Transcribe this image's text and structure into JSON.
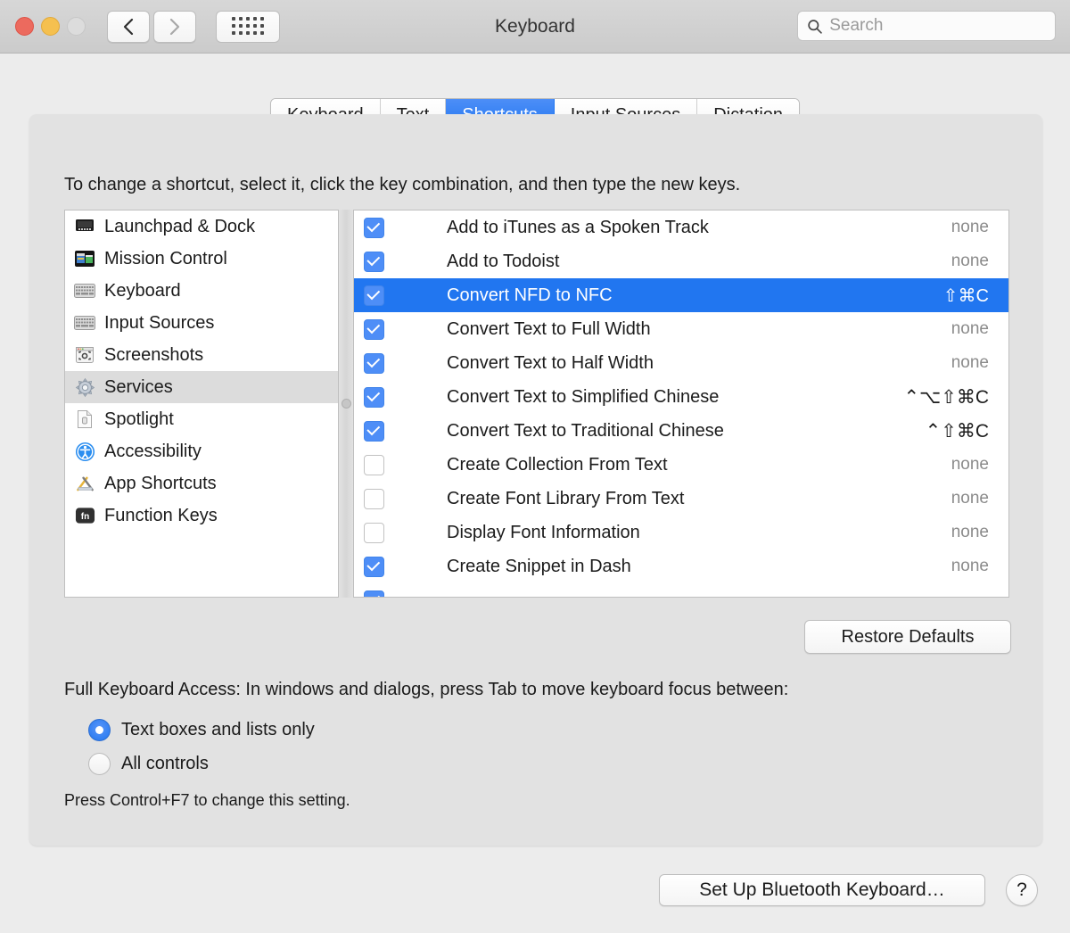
{
  "window": {
    "title": "Keyboard",
    "traffic_lights": [
      "close",
      "minimize",
      "zoom"
    ],
    "back_label": "Back",
    "forward_label": "Forward",
    "grid_label": "Show All"
  },
  "search": {
    "placeholder": "Search",
    "value": ""
  },
  "tabs": [
    {
      "label": "Keyboard",
      "active": false
    },
    {
      "label": "Text",
      "active": false
    },
    {
      "label": "Shortcuts",
      "active": true
    },
    {
      "label": "Input Sources",
      "active": false
    },
    {
      "label": "Dictation",
      "active": false
    }
  ],
  "hint": "To change a shortcut, select it, click the key combination, and then type the new keys.",
  "sidebar": {
    "items": [
      {
        "label": "Launchpad & Dock",
        "icon": "launchpad-dock-icon",
        "selected": false
      },
      {
        "label": "Mission Control",
        "icon": "mission-control-icon",
        "selected": false
      },
      {
        "label": "Keyboard",
        "icon": "keyboard-icon",
        "selected": false
      },
      {
        "label": "Input Sources",
        "icon": "input-sources-icon",
        "selected": false
      },
      {
        "label": "Screenshots",
        "icon": "screenshots-icon",
        "selected": false
      },
      {
        "label": "Services",
        "icon": "services-gear-icon",
        "selected": true
      },
      {
        "label": "Spotlight",
        "icon": "spotlight-icon",
        "selected": false
      },
      {
        "label": "Accessibility",
        "icon": "accessibility-icon",
        "selected": false
      },
      {
        "label": "App Shortcuts",
        "icon": "app-shortcuts-icon",
        "selected": false
      },
      {
        "label": "Function Keys",
        "icon": "function-keys-fn-icon",
        "selected": false
      }
    ]
  },
  "shortcuts": {
    "none_label": "none",
    "rows": [
      {
        "name": "Add to iTunes as a Spoken Track",
        "key": "none",
        "checked": true,
        "selected": false,
        "has_key": false
      },
      {
        "name": "Add to Todoist",
        "key": "none",
        "checked": true,
        "selected": false,
        "has_key": false
      },
      {
        "name": "Convert NFD to NFC",
        "key": "⇧⌘C",
        "checked": true,
        "selected": true,
        "has_key": true
      },
      {
        "name": "Convert Text to Full Width",
        "key": "none",
        "checked": true,
        "selected": false,
        "has_key": false
      },
      {
        "name": "Convert Text to Half Width",
        "key": "none",
        "checked": true,
        "selected": false,
        "has_key": false
      },
      {
        "name": "Convert Text to Simplified Chinese",
        "key": "⌃⌥⇧⌘C",
        "checked": true,
        "selected": false,
        "has_key": true
      },
      {
        "name": "Convert Text to Traditional Chinese",
        "key": "⌃⇧⌘C",
        "checked": true,
        "selected": false,
        "has_key": true
      },
      {
        "name": "Create Collection From Text",
        "key": "none",
        "checked": false,
        "selected": false,
        "has_key": false
      },
      {
        "name": "Create Font Library From Text",
        "key": "none",
        "checked": false,
        "selected": false,
        "has_key": false
      },
      {
        "name": "Display Font Information",
        "key": "none",
        "checked": false,
        "selected": false,
        "has_key": false
      },
      {
        "name": "Create Snippet in Dash",
        "key": "none",
        "checked": true,
        "selected": false,
        "has_key": false
      },
      {
        "name": "",
        "key": "",
        "checked": true,
        "selected": false,
        "has_key": false
      }
    ]
  },
  "restore_defaults_label": "Restore Defaults",
  "full_keyboard_access": {
    "description": "Full Keyboard Access: In windows and dialogs, press Tab to move keyboard focus between:",
    "options": [
      {
        "label": "Text boxes and lists only",
        "selected": true
      },
      {
        "label": "All controls",
        "selected": false
      }
    ],
    "note": "Press Control+F7 to change this setting."
  },
  "footer": {
    "bluetooth_label": "Set Up Bluetooth Keyboard…",
    "help_label": "?"
  },
  "colors": {
    "accent": "#2176f0",
    "checkbox": "#4e8ef7",
    "window_bg": "#ececec",
    "panel_bg": "#e2e2e2"
  }
}
